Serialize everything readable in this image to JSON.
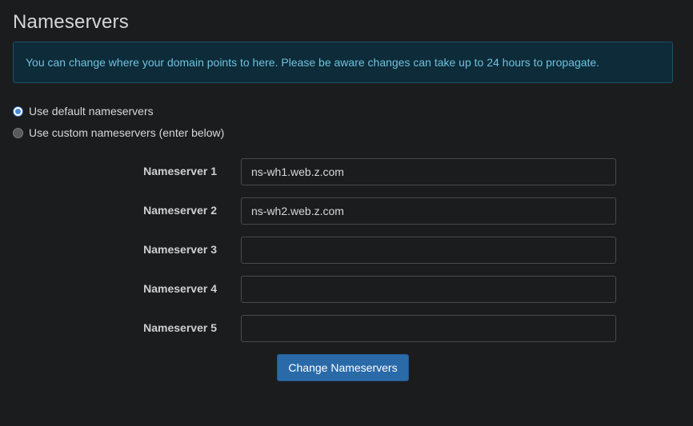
{
  "page": {
    "title": "Nameservers"
  },
  "alert": {
    "text": "You can change where your domain points to here. Please be aware changes can take up to 24 hours to propagate."
  },
  "options": {
    "default_label": "Use default nameservers",
    "custom_label": "Use custom nameservers (enter below)",
    "selected": "default"
  },
  "nameservers": [
    {
      "label": "Nameserver 1",
      "value": "ns-wh1.web.z.com"
    },
    {
      "label": "Nameserver 2",
      "value": "ns-wh2.web.z.com"
    },
    {
      "label": "Nameserver 3",
      "value": ""
    },
    {
      "label": "Nameserver 4",
      "value": ""
    },
    {
      "label": "Nameserver 5",
      "value": ""
    }
  ],
  "actions": {
    "submit_label": "Change Nameservers"
  },
  "colors": {
    "background": "#1b1c1e",
    "alert_background": "#0d2b38",
    "alert_text": "#6ec2e0",
    "primary_button": "#2a6aa8"
  }
}
